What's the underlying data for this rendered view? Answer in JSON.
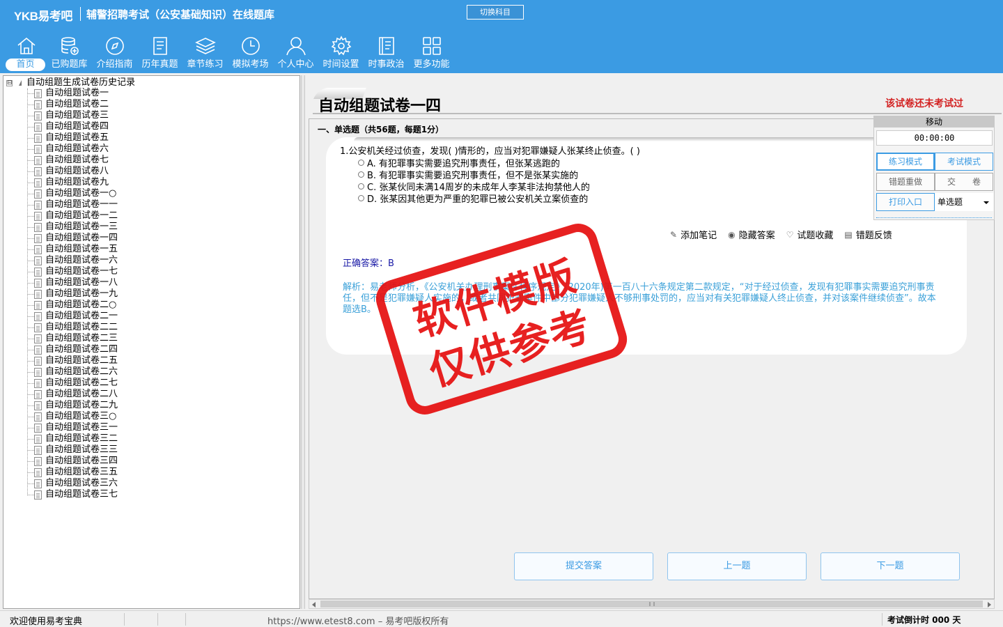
{
  "header": {
    "logo": "YKB易考吧",
    "title": "辅警招聘考试（公安基础知识）在线题库",
    "switch_label": "切换科目"
  },
  "nav": [
    {
      "label": "首页",
      "icon": "home-icon"
    },
    {
      "label": "已购题库",
      "icon": "database-icon"
    },
    {
      "label": "介绍指南",
      "icon": "compass-icon"
    },
    {
      "label": "历年真题",
      "icon": "document-icon"
    },
    {
      "label": "章节练习",
      "icon": "layers-icon"
    },
    {
      "label": "模拟考场",
      "icon": "clock-icon"
    },
    {
      "label": "个人中心",
      "icon": "user-icon"
    },
    {
      "label": "时间设置",
      "icon": "gear-icon"
    },
    {
      "label": "时事政治",
      "icon": "book-icon"
    },
    {
      "label": "更多功能",
      "icon": "grid-icon"
    }
  ],
  "tree": {
    "root_toggle": "⊟",
    "root": "自动组题生成试卷历史记录",
    "items": [
      "自动组题试卷一",
      "自动组题试卷二",
      "自动组题试卷三",
      "自动组题试卷四",
      "自动组题试卷五",
      "自动组题试卷六",
      "自动组题试卷七",
      "自动组题试卷八",
      "自动组题试卷九",
      "自动组题试卷一○",
      "自动组题试卷一一",
      "自动组题试卷一二",
      "自动组题试卷一三",
      "自动组题试卷一四",
      "自动组题试卷一五",
      "自动组题试卷一六",
      "自动组题试卷一七",
      "自动组题试卷一八",
      "自动组题试卷一九",
      "自动组题试卷二○",
      "自动组题试卷二一",
      "自动组题试卷二二",
      "自动组题试卷二三",
      "自动组题试卷二四",
      "自动组题试卷二五",
      "自动组题试卷二六",
      "自动组题试卷二七",
      "自动组题试卷二八",
      "自动组题试卷二九",
      "自动组题试卷三○",
      "自动组题试卷三一",
      "自动组题试卷三二",
      "自动组题试卷三三",
      "自动组题试卷三四",
      "自动组题试卷三五",
      "自动组题试卷三六",
      "自动组题试卷三七"
    ]
  },
  "paper": {
    "title": "自动组题试卷一四",
    "status": "该试卷还未考试过",
    "section": "一、单选题（共56题，每题1分）"
  },
  "question": {
    "stem": "1.公安机关经过侦查，发现( )情形的，应当对犯罪嫌疑人张某终止侦查。( )",
    "options": [
      "A. 有犯罪事实需要追究刑事责任，但张某逃跑的",
      "B. 有犯罪事实需要追究刑事责任，但不是张某实施的",
      "C. 张某伙同未满14周岁的未成年人李某非法拘禁他人的",
      "D. 张某因其他更为严重的犯罪已被公安机关立案侦查的"
    ],
    "answer": "正确答案：B",
    "analysis": "解析：易老师分析，《公安机关办理刑事案件程序规定》(2020年)第一百八十六条规定第二款规定，“对于经过侦查，发现有犯罪事实需要追究刑事责任，但不是犯罪嫌疑人实施的，或者共同犯罪案件中部分犯罪嫌疑人不够刑事处罚的，应当对有关犯罪嫌疑人终止侦查，并对该案件继续侦查”。故本题选B。"
  },
  "tools": [
    {
      "label": "添加笔记",
      "icon": "pencil-icon"
    },
    {
      "label": "隐藏答案",
      "icon": "eye-off-icon"
    },
    {
      "label": "试题收藏",
      "icon": "heart-icon"
    },
    {
      "label": "错题反馈",
      "icon": "feedback-icon"
    }
  ],
  "control": {
    "move": "移动",
    "timer": "00:00:00",
    "practice": "练习模式",
    "exam": "考试模式",
    "redo": "错题重做",
    "submit": "交　　卷",
    "print": "打印入口",
    "type_selected": "单选题"
  },
  "buttons": {
    "submit_answer": "提交答案",
    "prev": "上一题",
    "next": "下一题"
  },
  "stamp": {
    "line1": "软件模版",
    "line2": "仅供参考"
  },
  "footer": {
    "welcome": "欢迎使用易考宝典",
    "url": "https://www.etest8.com – 易考吧版权所有",
    "countdown": "考试倒计时 000 天"
  }
}
